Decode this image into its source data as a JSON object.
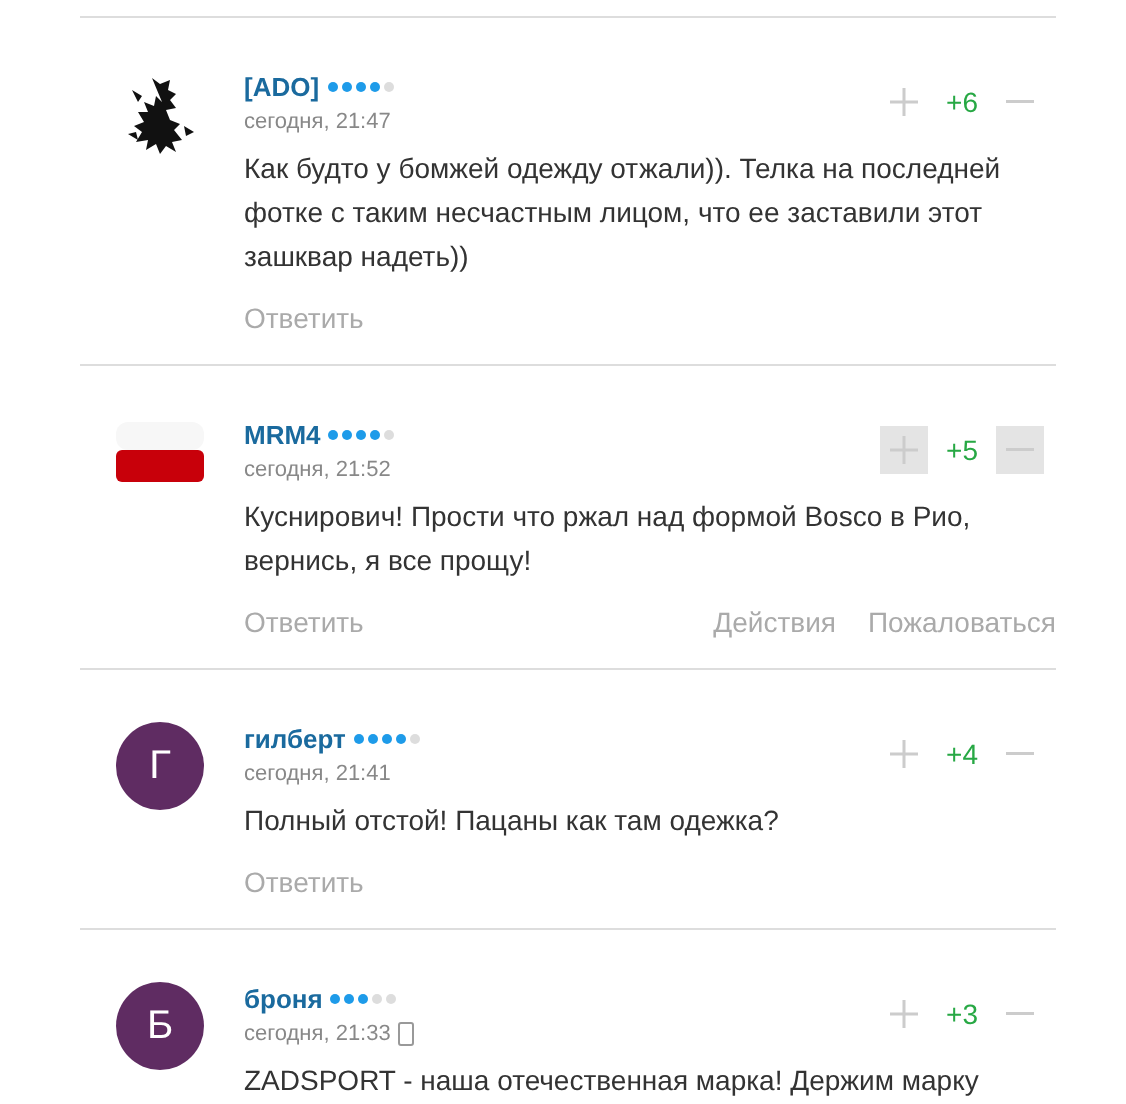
{
  "comments": [
    {
      "author": "[ADO]",
      "stars": 4,
      "time": "сегодня, 21:47",
      "mobile": false,
      "avatar": {
        "kind": "lion"
      },
      "score": "+6",
      "votes_highlighted": false,
      "text": "Как будто у бомжей одежду отжали)). Телка на последней фотке с таким несчастным лицом, что ее заставили этот зашквар надеть))",
      "reply": "Ответить"
    },
    {
      "author": "MRM4",
      "stars": 4,
      "time": "сегодня, 21:52",
      "mobile": false,
      "avatar": {
        "kind": "flag"
      },
      "score": "+5",
      "votes_highlighted": true,
      "text": "Куснирович! Прости что ржал над формой Bosco в Рио, вернись, я все прощу!",
      "reply": "Ответить",
      "actions": [
        "Действия",
        "Пожаловаться"
      ]
    },
    {
      "author": "гилберт",
      "stars": 4,
      "time": "сегодня, 21:41",
      "mobile": false,
      "avatar": {
        "kind": "letter",
        "letter": "Г"
      },
      "score": "+4",
      "votes_highlighted": false,
      "text": "Полный отстой! Пацаны как там одежка?",
      "reply": "Ответить"
    },
    {
      "author": "броня",
      "stars": 3,
      "time": "сегодня, 21:33",
      "mobile": true,
      "avatar": {
        "kind": "letter",
        "letter": "Б"
      },
      "score": "+3",
      "votes_highlighted": false,
      "text": "ZADSPORT - наша отечественная марка! Держим марку"
    }
  ]
}
